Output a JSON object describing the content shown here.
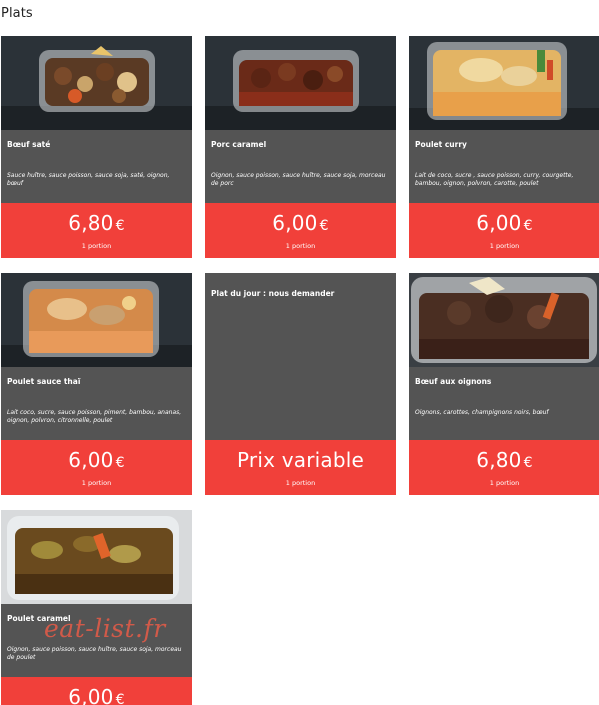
{
  "section": {
    "title": "Plats"
  },
  "cards": [
    {
      "name": "Bœuf saté",
      "desc": "Sauce huître, sauce poisson, sauce soja, saté, oignon, bœuf",
      "price": "6,80",
      "currency": "€",
      "portion": "1 portion"
    },
    {
      "name": "Porc caramel",
      "desc": "Oignon, sauce poisson, sauce huître, sauce soja, morceau de porc",
      "price": "6,00",
      "currency": "€",
      "portion": "1 portion"
    },
    {
      "name": "Poulet curry",
      "desc": "Lait de coco, sucre , sauce poisson, curry, courgette, bambou, oignon, polvron, carotte, poulet",
      "price": "6,00",
      "currency": "€",
      "portion": "1 portion"
    },
    {
      "name": "Poulet sauce thaï",
      "desc": "Lait coco, sucre, sauce poisson, piment, bambou, ananas, oignon, polvron, citronnelle, poulet",
      "price": "6,00",
      "currency": "€",
      "portion": "1 portion"
    },
    {
      "name": "Plat du jour : nous demander",
      "desc": "",
      "price": "Prix variable",
      "currency": "",
      "portion": "1 portion"
    },
    {
      "name": "Bœuf aux oignons",
      "desc": "Oignons, carottes, champignons noirs, bœuf",
      "price": "6,80",
      "currency": "€",
      "portion": "1 portion"
    },
    {
      "name": "Poulet caramel",
      "desc": "Oignon, sauce poisson, sauce huître, sauce soja, morceau de poulet",
      "price": "6,00",
      "currency": "€",
      "portion": ""
    }
  ],
  "watermark": "eat-list.fr"
}
